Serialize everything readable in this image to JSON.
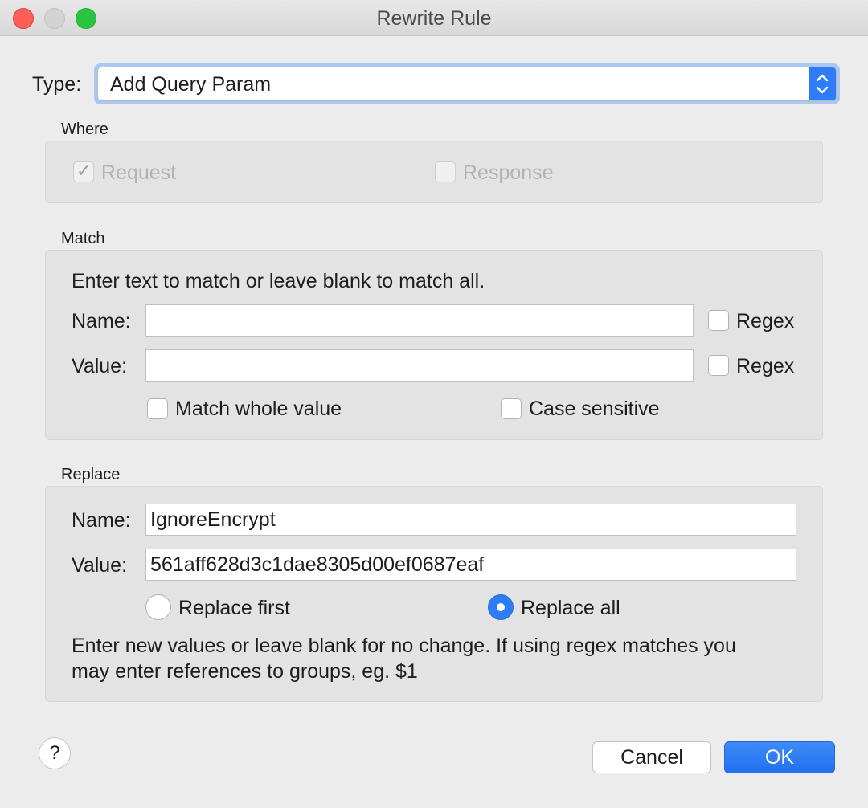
{
  "window": {
    "title": "Rewrite Rule"
  },
  "type": {
    "label": "Type:",
    "selected": "Add Query Param"
  },
  "where": {
    "title": "Where",
    "request_label": "Request",
    "request_checked": true,
    "response_label": "Response",
    "response_checked": false
  },
  "match": {
    "title": "Match",
    "instructions": "Enter text to match or leave blank to match all.",
    "name_label": "Name:",
    "name_value": "",
    "value_label": "Value:",
    "value_value": "",
    "regex_label": "Regex",
    "match_whole_label": "Match whole value",
    "case_sensitive_label": "Case sensitive"
  },
  "replace": {
    "title": "Replace",
    "name_label": "Name:",
    "name_value": "IgnoreEncrypt",
    "value_label": "Value:",
    "value_value": "561aff628d3c1dae8305d00ef0687eaf",
    "replace_first_label": "Replace first",
    "replace_all_label": "Replace all",
    "selected_mode": "Replace all",
    "help_line1": "Enter new values or leave blank for no change. If using regex matches you",
    "help_line2": "may enter references to groups, eg. $1"
  },
  "footer": {
    "help": "?",
    "cancel": "Cancel",
    "ok": "OK"
  },
  "colors": {
    "accent": "#2f7df6",
    "close": "#fc5f57",
    "maximize": "#29c540"
  }
}
